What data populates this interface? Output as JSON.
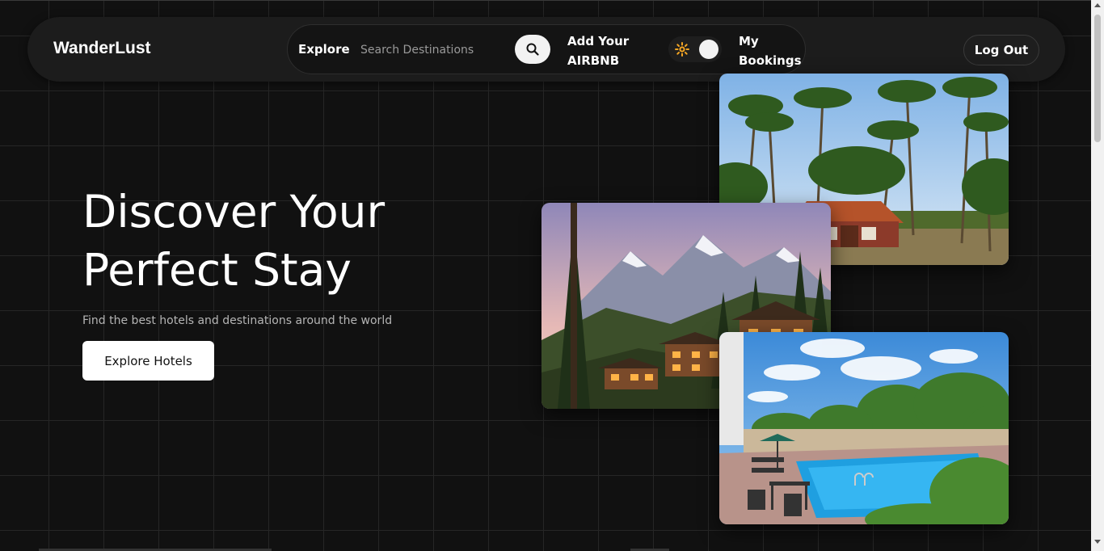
{
  "navbar": {
    "brand": "WanderLust",
    "explore_label": "Explore",
    "search_placeholder": "Search Destinations",
    "add_listing_label": "Add Your AIRBNB",
    "my_bookings_label": "My Bookings",
    "logout_label": "Log Out",
    "search_icon": "search-icon",
    "theme_icon": "sun-icon"
  },
  "hero": {
    "title": "Discover Your Perfect Stay",
    "subtitle": "Find the best hotels and destinations around the world",
    "cta_label": "Explore Hotels"
  },
  "colors": {
    "background": "#111111",
    "grid_line": "#262626",
    "navbar": "#1c1c1c",
    "sun_accent": "#f5a623"
  }
}
